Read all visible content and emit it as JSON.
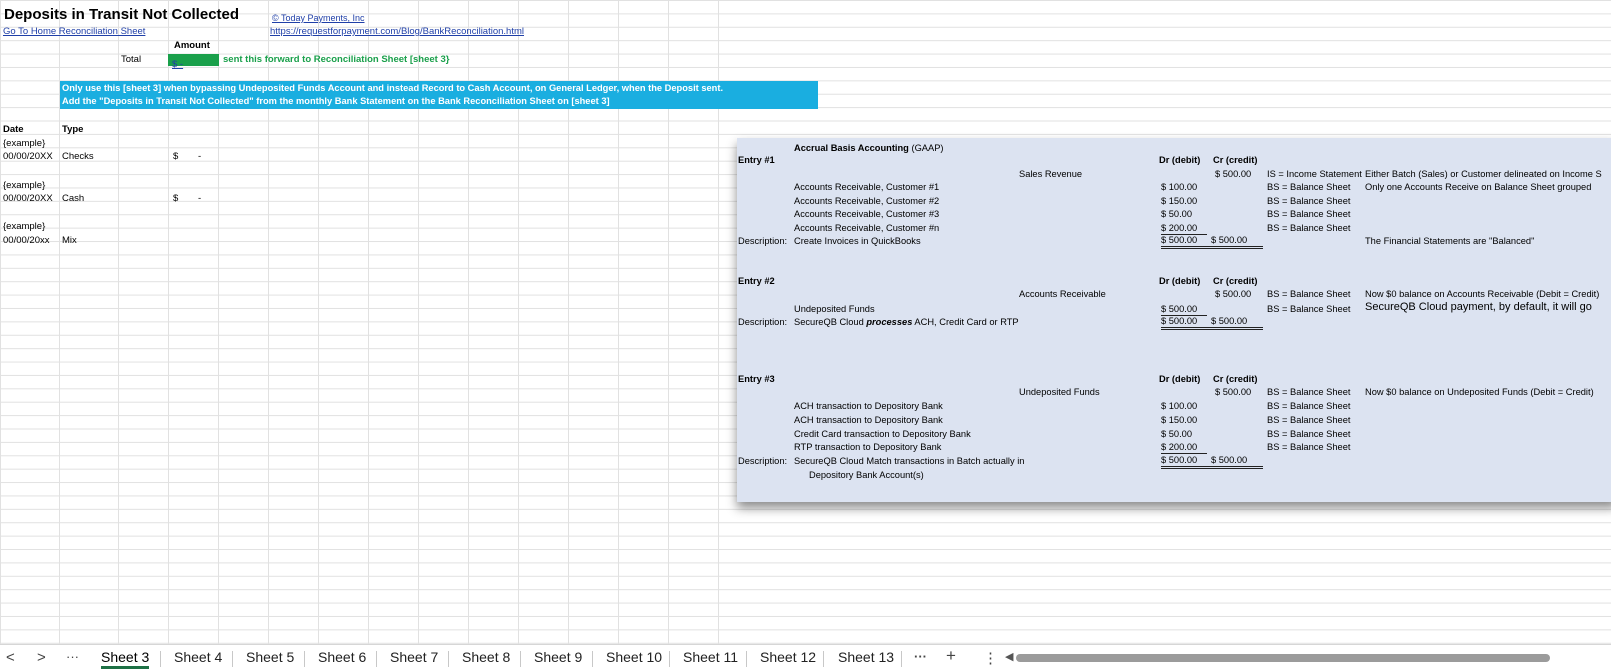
{
  "sheet": {
    "title": "Deposits in Transit Not Collected",
    "copyright": "© Today Payments, Inc",
    "home_link": "Go To Home Reconciliation Sheet",
    "url": "https://requestforpayment.com/Blog/BankReconciliation.html",
    "amount_header": "Amount",
    "total_label": "Total",
    "total_value": "$      -",
    "forward_note": "sent this forward to Reconciliation Sheet [sheet 3}",
    "banner_line1": "Only use this [sheet 3] when bypassing Undeposited Funds Account and instead Record to Cash Account, on General Ledger, when the Deposit sent.",
    "banner_line2": "Add the \"Deposits in Transit Not Collected\" from the monthly Bank Statement on the Bank Reconciliation Sheet on [sheet 3]",
    "col_date": "Date",
    "col_type": "Type",
    "rows": [
      {
        "example": "{example}",
        "date": "00/00/20XX",
        "type": "Checks",
        "dollar": "$",
        "value": "-"
      },
      {
        "example": "{example}",
        "date": "00/00/20XX",
        "type": "Cash",
        "dollar": "$",
        "value": "-"
      },
      {
        "example": "{example}",
        "date": "00/00/20xx",
        "type": "Mix",
        "dollar": "",
        "value": ""
      }
    ]
  },
  "picture": {
    "heading": "Accrual Basis Accounting",
    "heading_suffix": "(GAAP)",
    "dr": "Dr (debit)",
    "cr": "Cr (credit)",
    "desc_label": "Description:",
    "entry1": {
      "label": "Entry #1",
      "account": "Sales Revenue",
      "credit": "$    500.00",
      "credit_note": "IS = Income Statement",
      "note1": "Either Batch (Sales) or Customer delineated on Income S",
      "note2": "Only one Accounts Receive on Balance Sheet grouped",
      "lines": [
        "Accounts Receivable, Customer #1",
        "Accounts Receivable, Customer #2",
        "Accounts Receivable, Customer #3",
        "Accounts Receivable, Customer #n"
      ],
      "debits": [
        "$    100.00",
        "$    150.00",
        "$      50.00",
        "$    200.00"
      ],
      "bs": "BS = Balance Sheet",
      "description": "Create Invoices in QuickBooks",
      "total_dr": "$   500.00",
      "total_cr": "$    500.00",
      "balanced": "The Financial Statements are \"Balanced\""
    },
    "entry2": {
      "label": "Entry #2",
      "account": "Accounts Receivable",
      "credit": "$    500.00",
      "line": "Undeposited Funds",
      "debit": "$    500.00",
      "description_pre": "SecureQB Cloud ",
      "description_em": "processes",
      "description_post": " ACH, Credit Card or RTP",
      "total_dr": "$   500.00",
      "total_cr": "$    500.00",
      "note1": "Now $0 balance on Accounts Receivable (Debit = Credit)",
      "note2": "SecureQB Cloud payment, by default, it will go"
    },
    "entry3": {
      "label": "Entry #3",
      "account": "Undeposited Funds",
      "credit": "$    500.00",
      "lines": [
        "ACH transaction to Depository Bank",
        "ACH transaction to Depository Bank",
        "Credit Card transaction to Depository Bank",
        "RTP transaction to Depository Bank"
      ],
      "debits": [
        "$    100.00",
        "$    150.00",
        "$      50.00",
        "$    200.00"
      ],
      "description": "SecureQB Cloud Match transactions in Batch actually in",
      "description2": "Depository Bank Account(s)",
      "total_dr": "$   500.00",
      "total_cr": "$    500.00",
      "note1": "Now $0 balance on Undeposited Funds (Debit = Credit)"
    }
  },
  "tabs": {
    "prev": "<",
    "next": ">",
    "more_left": "···",
    "items": [
      "Sheet 3",
      "Sheet 4",
      "Sheet 5",
      "Sheet 6",
      "Sheet 7",
      "Sheet 8",
      "Sheet 9",
      "Sheet 10",
      "Sheet 11",
      "Sheet 12",
      "Sheet 13"
    ],
    "more_right": "···",
    "add": "+",
    "options": "⋮",
    "scroll_left": "◀"
  }
}
